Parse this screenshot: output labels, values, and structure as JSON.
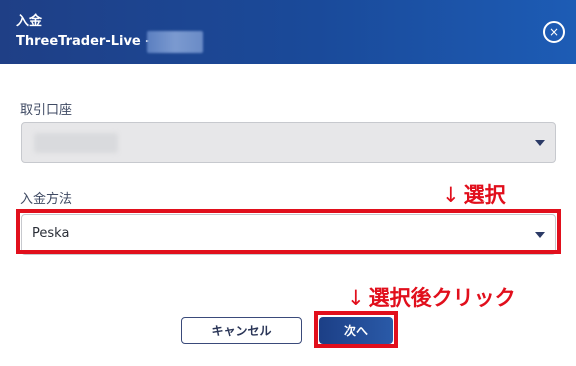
{
  "dialog": {
    "title": "入金",
    "subtitle": "ThreeTrader-Live -",
    "close_icon": "×"
  },
  "form": {
    "account_label": "取引口座",
    "account_value": "",
    "method_label": "入金方法",
    "method_value": "Peska"
  },
  "annotations": {
    "arrow": "↓",
    "select_note": "選択",
    "click_note": "選択後クリック",
    "color": "#e10f1c"
  },
  "buttons": {
    "cancel_label": "キャンセル",
    "next_label": "次へ"
  },
  "colors": {
    "header": "#1f3f86",
    "primary": "#1c3f86"
  }
}
